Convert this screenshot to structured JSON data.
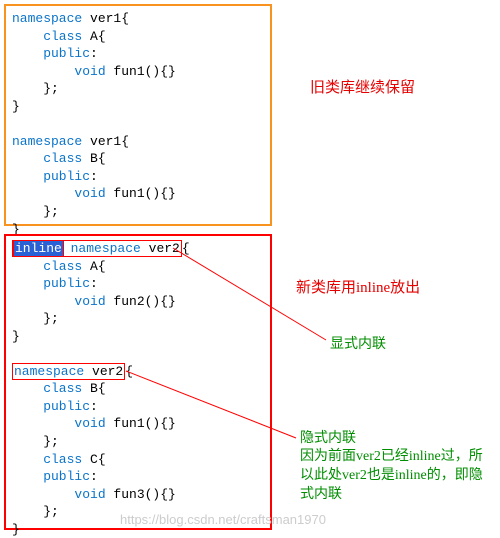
{
  "annotations": {
    "old_lib": "旧类库继续保留",
    "new_lib": "新类库用inline放出",
    "explicit": "显式内联",
    "implicit_title": "隐式内联",
    "implicit_body": "因为前面ver2已经inline过，所以此处ver2也是inline的，即隐式内联"
  },
  "code": {
    "block1": {
      "l1a": "namespace",
      "l1b": " ver1{",
      "l2a": "    class",
      "l2b": " A{",
      "l3a": "    public",
      "l3b": ":",
      "l4a": "        void",
      "l4b": " fun1(){}",
      "l5": "    };",
      "l6": "}",
      "l7": "",
      "l8a": "namespace",
      "l8b": " ver1{",
      "l9a": "    class",
      "l9b": " B{",
      "l10a": "    public",
      "l10b": ":",
      "l11a": "        void",
      "l11b": " fun1(){}",
      "l12": "    };",
      "l13": "}"
    },
    "block2": {
      "l1a": "inline",
      "l1b": "namespace",
      "l1c": " ver2",
      "l1d": "{",
      "l2a": "    class",
      "l2b": " A{",
      "l3a": "    public",
      "l3b": ":",
      "l4a": "        void",
      "l4b": " fun2(){}",
      "l5": "    };",
      "l6": "}",
      "l7": "",
      "l8a": "namespace",
      "l8b": " ver2",
      "l8c": "{",
      "l9a": "    class",
      "l9b": " B{",
      "l10a": "    public",
      "l10b": ":",
      "l11a": "        void",
      "l11b": " fun1(){}",
      "l12": "    };",
      "l13a": "    class",
      "l13b": " C{",
      "l14a": "    public",
      "l14b": ":",
      "l15a": "        void",
      "l15b": " fun3(){}",
      "l16": "    };",
      "l17": "}"
    }
  },
  "watermark": "https://blog.csdn.net/craftsman1970"
}
